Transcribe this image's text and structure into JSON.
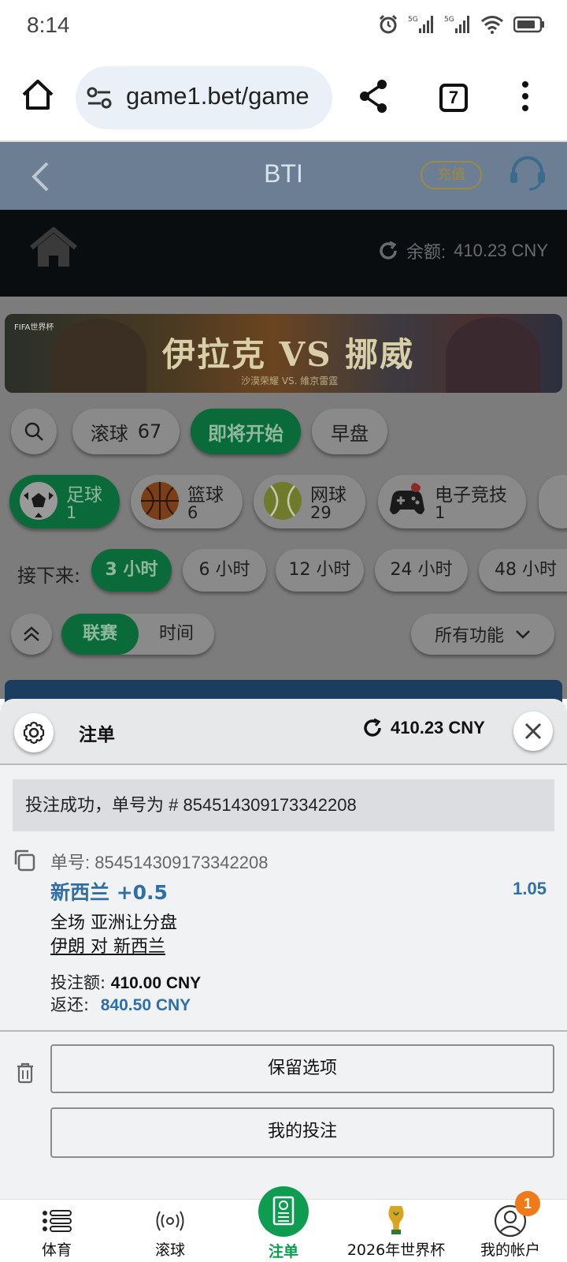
{
  "status_bar": {
    "time": "8:14"
  },
  "browser": {
    "url": "game1.bet/game",
    "tab_count": "7"
  },
  "app_header": {
    "title": "BTI",
    "recharge": "充值"
  },
  "site_header": {
    "balance_label": "余额:",
    "balance_value": "410.23 CNY"
  },
  "banner": {
    "tag": "FIFA世界杯",
    "headline": "伊拉克 VS 挪威",
    "subline": "沙漠荣耀 VS. 維京雷霆"
  },
  "filters": {
    "live": {
      "label": "滚球",
      "count": "67"
    },
    "soon": {
      "label": "即将开始"
    },
    "early": {
      "label": "早盘"
    }
  },
  "sports": [
    {
      "name": "足球",
      "count": "1"
    },
    {
      "name": "篮球",
      "count": "6"
    },
    {
      "name": "网球",
      "count": "29"
    },
    {
      "name": "电子竞技",
      "count": "1"
    }
  ],
  "time_filter": {
    "label": "接下来:",
    "options": [
      "3 小时",
      "6 小时",
      "12 小时",
      "24 小时",
      "48 小时"
    ]
  },
  "view_toggle": {
    "league": "联赛",
    "time": "时间"
  },
  "all_features": "所有功能",
  "bet_slip": {
    "title": "注单",
    "balance": "410.23 CNY",
    "success_message": "投注成功，单号为 # 854514309173342208",
    "ticket_label": "单号: 854514309173342208",
    "selection": "新西兰 +0.5",
    "odds": "1.05",
    "market": "全场 亚洲让分盘",
    "match": "伊朗 对 新西兰",
    "stake_label": "投注额:",
    "stake_value": "410.00 CNY",
    "return_label": "返还:",
    "return_value": "840.50 CNY",
    "keep_button": "保留选项",
    "my_bets_button": "我的投注"
  },
  "bottom_nav": {
    "sports": "体育",
    "live": "滚球",
    "betslip": "注单",
    "worldcup": "2026年世界杯",
    "account": "我的帐户",
    "account_badge": "1"
  },
  "colors": {
    "green": "#0a6a3a",
    "accent_blue": "#2f6fa8",
    "nav_green": "#0d9c50"
  }
}
